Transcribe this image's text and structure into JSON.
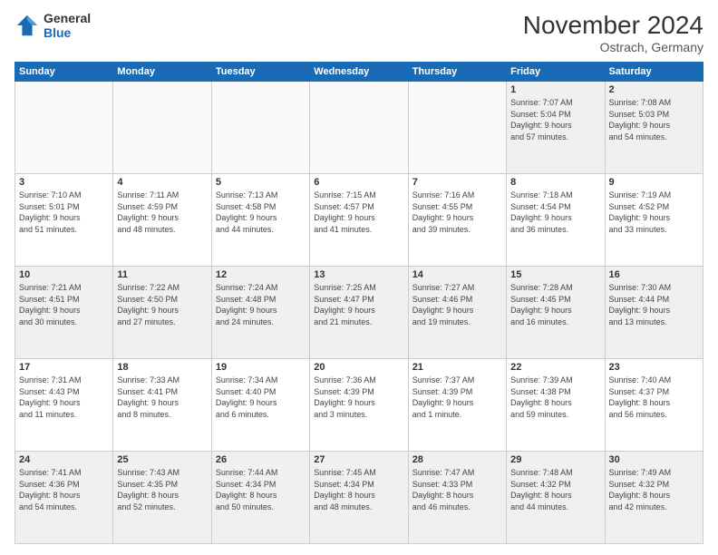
{
  "logo": {
    "line1": "General",
    "line2": "Blue"
  },
  "title": "November 2024",
  "location": "Ostrach, Germany",
  "days_header": [
    "Sunday",
    "Monday",
    "Tuesday",
    "Wednesday",
    "Thursday",
    "Friday",
    "Saturday"
  ],
  "weeks": [
    [
      {
        "day": "",
        "info": "",
        "empty": true
      },
      {
        "day": "",
        "info": "",
        "empty": true
      },
      {
        "day": "",
        "info": "",
        "empty": true
      },
      {
        "day": "",
        "info": "",
        "empty": true
      },
      {
        "day": "",
        "info": "",
        "empty": true
      },
      {
        "day": "1",
        "info": "Sunrise: 7:07 AM\nSunset: 5:04 PM\nDaylight: 9 hours\nand 57 minutes."
      },
      {
        "day": "2",
        "info": "Sunrise: 7:08 AM\nSunset: 5:03 PM\nDaylight: 9 hours\nand 54 minutes."
      }
    ],
    [
      {
        "day": "3",
        "info": "Sunrise: 7:10 AM\nSunset: 5:01 PM\nDaylight: 9 hours\nand 51 minutes."
      },
      {
        "day": "4",
        "info": "Sunrise: 7:11 AM\nSunset: 4:59 PM\nDaylight: 9 hours\nand 48 minutes."
      },
      {
        "day": "5",
        "info": "Sunrise: 7:13 AM\nSunset: 4:58 PM\nDaylight: 9 hours\nand 44 minutes."
      },
      {
        "day": "6",
        "info": "Sunrise: 7:15 AM\nSunset: 4:57 PM\nDaylight: 9 hours\nand 41 minutes."
      },
      {
        "day": "7",
        "info": "Sunrise: 7:16 AM\nSunset: 4:55 PM\nDaylight: 9 hours\nand 39 minutes."
      },
      {
        "day": "8",
        "info": "Sunrise: 7:18 AM\nSunset: 4:54 PM\nDaylight: 9 hours\nand 36 minutes."
      },
      {
        "day": "9",
        "info": "Sunrise: 7:19 AM\nSunset: 4:52 PM\nDaylight: 9 hours\nand 33 minutes."
      }
    ],
    [
      {
        "day": "10",
        "info": "Sunrise: 7:21 AM\nSunset: 4:51 PM\nDaylight: 9 hours\nand 30 minutes."
      },
      {
        "day": "11",
        "info": "Sunrise: 7:22 AM\nSunset: 4:50 PM\nDaylight: 9 hours\nand 27 minutes."
      },
      {
        "day": "12",
        "info": "Sunrise: 7:24 AM\nSunset: 4:48 PM\nDaylight: 9 hours\nand 24 minutes."
      },
      {
        "day": "13",
        "info": "Sunrise: 7:25 AM\nSunset: 4:47 PM\nDaylight: 9 hours\nand 21 minutes."
      },
      {
        "day": "14",
        "info": "Sunrise: 7:27 AM\nSunset: 4:46 PM\nDaylight: 9 hours\nand 19 minutes."
      },
      {
        "day": "15",
        "info": "Sunrise: 7:28 AM\nSunset: 4:45 PM\nDaylight: 9 hours\nand 16 minutes."
      },
      {
        "day": "16",
        "info": "Sunrise: 7:30 AM\nSunset: 4:44 PM\nDaylight: 9 hours\nand 13 minutes."
      }
    ],
    [
      {
        "day": "17",
        "info": "Sunrise: 7:31 AM\nSunset: 4:43 PM\nDaylight: 9 hours\nand 11 minutes."
      },
      {
        "day": "18",
        "info": "Sunrise: 7:33 AM\nSunset: 4:41 PM\nDaylight: 9 hours\nand 8 minutes."
      },
      {
        "day": "19",
        "info": "Sunrise: 7:34 AM\nSunset: 4:40 PM\nDaylight: 9 hours\nand 6 minutes."
      },
      {
        "day": "20",
        "info": "Sunrise: 7:36 AM\nSunset: 4:39 PM\nDaylight: 9 hours\nand 3 minutes."
      },
      {
        "day": "21",
        "info": "Sunrise: 7:37 AM\nSunset: 4:39 PM\nDaylight: 9 hours\nand 1 minute."
      },
      {
        "day": "22",
        "info": "Sunrise: 7:39 AM\nSunset: 4:38 PM\nDaylight: 8 hours\nand 59 minutes."
      },
      {
        "day": "23",
        "info": "Sunrise: 7:40 AM\nSunset: 4:37 PM\nDaylight: 8 hours\nand 56 minutes."
      }
    ],
    [
      {
        "day": "24",
        "info": "Sunrise: 7:41 AM\nSunset: 4:36 PM\nDaylight: 8 hours\nand 54 minutes."
      },
      {
        "day": "25",
        "info": "Sunrise: 7:43 AM\nSunset: 4:35 PM\nDaylight: 8 hours\nand 52 minutes."
      },
      {
        "day": "26",
        "info": "Sunrise: 7:44 AM\nSunset: 4:34 PM\nDaylight: 8 hours\nand 50 minutes."
      },
      {
        "day": "27",
        "info": "Sunrise: 7:45 AM\nSunset: 4:34 PM\nDaylight: 8 hours\nand 48 minutes."
      },
      {
        "day": "28",
        "info": "Sunrise: 7:47 AM\nSunset: 4:33 PM\nDaylight: 8 hours\nand 46 minutes."
      },
      {
        "day": "29",
        "info": "Sunrise: 7:48 AM\nSunset: 4:32 PM\nDaylight: 8 hours\nand 44 minutes."
      },
      {
        "day": "30",
        "info": "Sunrise: 7:49 AM\nSunset: 4:32 PM\nDaylight: 8 hours\nand 42 minutes."
      }
    ]
  ]
}
